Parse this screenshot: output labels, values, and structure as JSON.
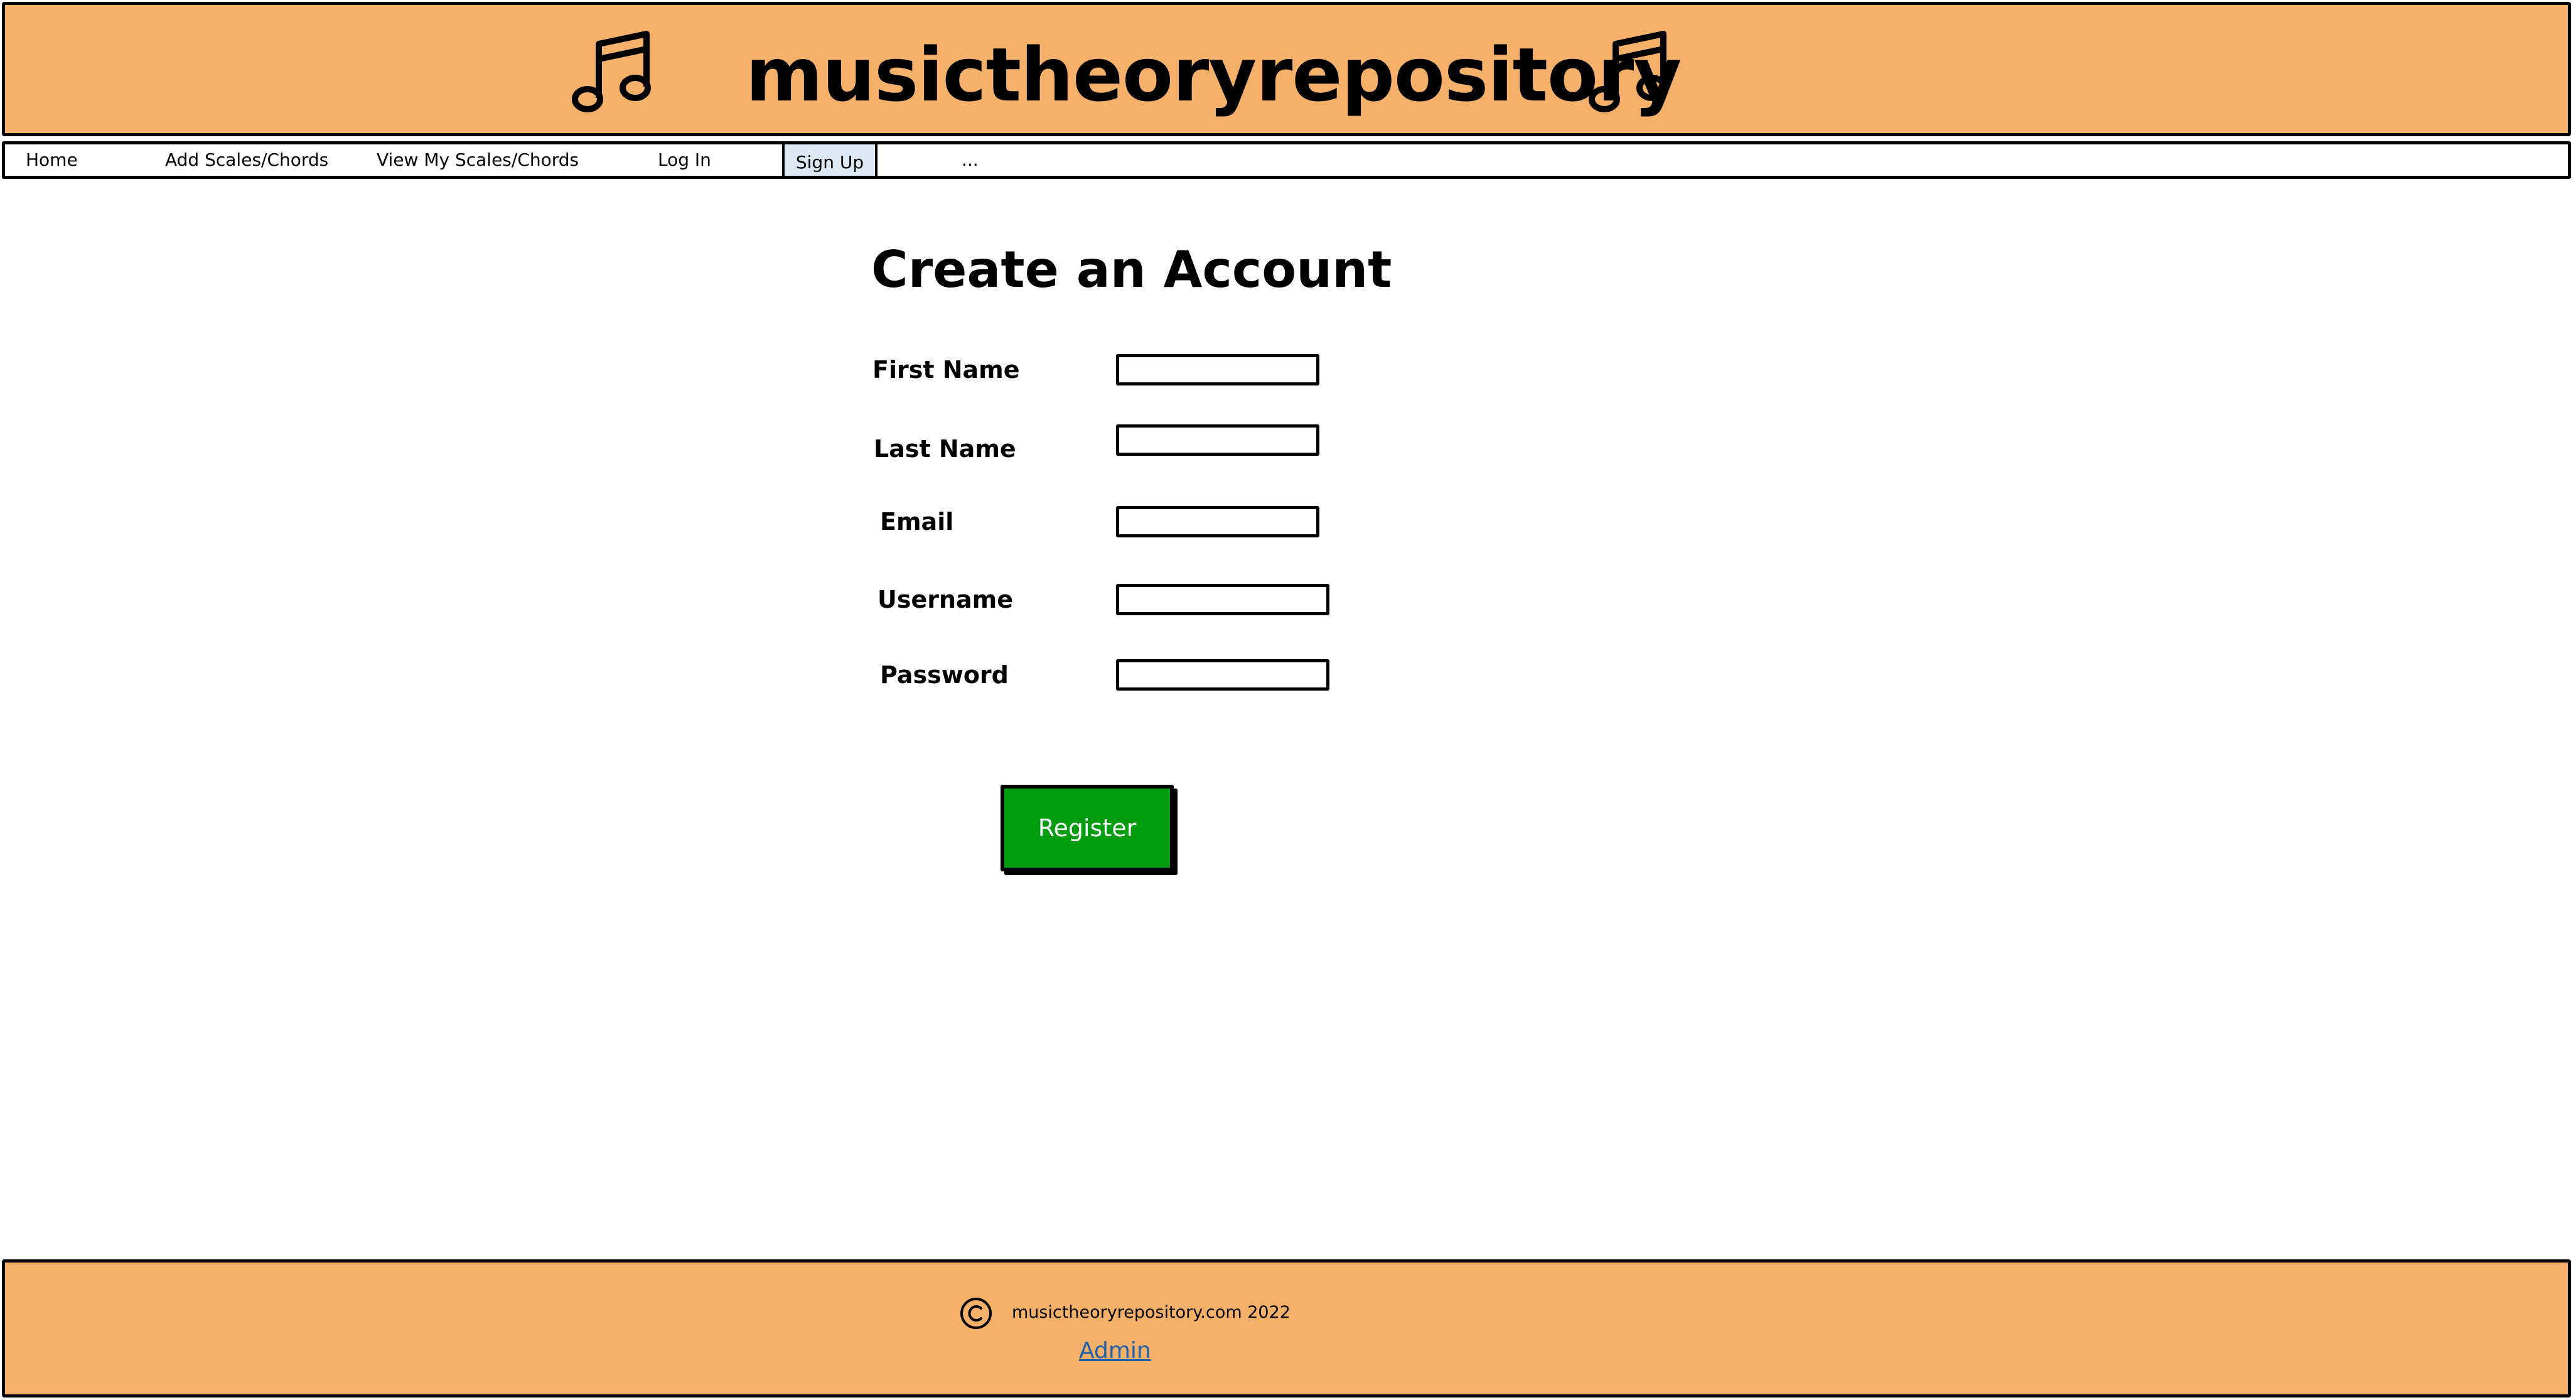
{
  "header": {
    "title": "musictheoryrepository",
    "left_icon": "music-notes-icon",
    "right_icon": "music-notes-icon",
    "background_color": "#f5b06a"
  },
  "nav": {
    "items": [
      {
        "label": "Home"
      },
      {
        "label": "Add Scales/Chords"
      },
      {
        "label": "View My Scales/Chords"
      },
      {
        "label": "Log In"
      },
      {
        "label": "Sign Up",
        "selected": true
      },
      {
        "label": "..."
      }
    ],
    "selected_color": "#dde8f5"
  },
  "form": {
    "title": "Create an Account",
    "fields": [
      {
        "label": "First Name",
        "value": ""
      },
      {
        "label": "Last Name",
        "value": ""
      },
      {
        "label": "Email",
        "value": ""
      },
      {
        "label": "Username",
        "value": ""
      },
      {
        "label": "Password",
        "value": ""
      }
    ],
    "submit_label": "Register",
    "submit_color": "#009c0f"
  },
  "footer": {
    "copyright_icon": "copyright-icon",
    "text": "musictheoryrepository.com 2022",
    "admin_link": "Admin",
    "background_color": "#f5b06a"
  }
}
